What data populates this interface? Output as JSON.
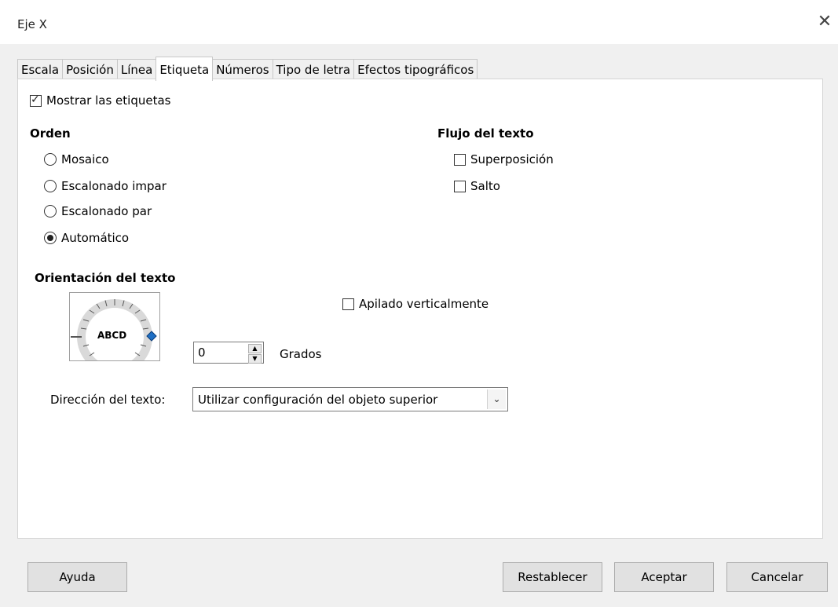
{
  "window": {
    "title": "Eje X",
    "close_icon": "close-icon"
  },
  "tabs": [
    {
      "label": "Escala"
    },
    {
      "label": "Posición"
    },
    {
      "label": "Línea"
    },
    {
      "label": "Etiqueta",
      "active": true
    },
    {
      "label": "Números"
    },
    {
      "label": "Tipo de letra"
    },
    {
      "label": "Efectos tipográficos"
    }
  ],
  "show_labels": {
    "label": "Mostrar las etiquetas",
    "checked": true
  },
  "order": {
    "heading": "Orden",
    "options": [
      {
        "label": "Mosaico",
        "selected": false
      },
      {
        "label": "Escalonado impar",
        "selected": false
      },
      {
        "label": "Escalonado par",
        "selected": false
      },
      {
        "label": "Automático",
        "selected": true
      }
    ]
  },
  "text_flow": {
    "heading": "Flujo del texto",
    "overlap": {
      "label": "Superposición",
      "checked": false
    },
    "break": {
      "label": "Salto",
      "checked": false
    }
  },
  "orientation": {
    "heading": "Orientación del texto",
    "dial_text": "ABCD",
    "stacked": {
      "label": "Apilado verticalmente",
      "checked": false
    },
    "degrees_value": "0",
    "degrees_label": "Grados"
  },
  "text_direction": {
    "label": "Dirección del texto:",
    "value": "Utilizar configuración del objeto superior"
  },
  "buttons": {
    "help": "Ayuda",
    "reset": "Restablecer",
    "ok": "Aceptar",
    "cancel": "Cancelar"
  },
  "colors": {
    "dial_marker": "#1f6fc4",
    "dial_ring": "#d9d9d9"
  }
}
